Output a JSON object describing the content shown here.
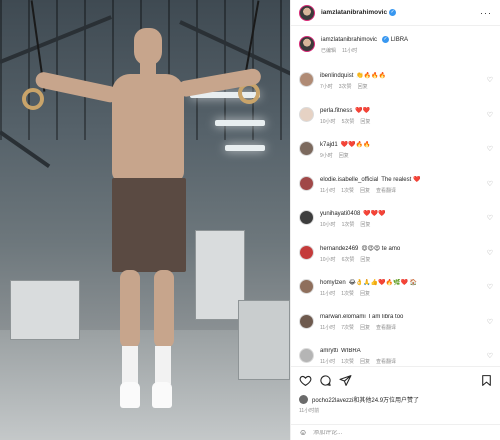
{
  "post": {
    "author": "iamzlatanibrahimovic",
    "caption": "LIBRA",
    "caption_status": "已编辑",
    "caption_time": "11小时"
  },
  "comments": [
    {
      "user": "ibenlindquist",
      "text": "👏🔥🔥🔥",
      "time": "7小时",
      "likes": "3次赞",
      "reply": "回复",
      "translate": ""
    },
    {
      "user": "perla.fitness",
      "text": "❤️❤️",
      "time": "10小时",
      "likes": "5次赞",
      "reply": "回复",
      "translate": ""
    },
    {
      "user": "k7ajd1",
      "text": "❤️❤️🔥🔥",
      "time": "9小时",
      "likes": "",
      "reply": "回复",
      "translate": ""
    },
    {
      "user": "elodie.isabelle_official",
      "text": "The realest ❤️",
      "time": "11小时",
      "likes": "1次赞",
      "reply": "回复",
      "translate": "查看翻译"
    },
    {
      "user": "yunihayati0408",
      "text": "❤️❤️❤️",
      "time": "10小时",
      "likes": "1次赞",
      "reply": "回复",
      "translate": ""
    },
    {
      "user": "hernandez469",
      "text": "😍😍😍 te amo",
      "time": "10小时",
      "likes": "6次赞",
      "reply": "回复",
      "translate": ""
    },
    {
      "user": "homylzen",
      "text": "😂👌🙏👍❤️🔥🌿❤️ 🏠",
      "time": "11小时",
      "likes": "1次赞",
      "reply": "回复",
      "translate": ""
    },
    {
      "user": "marwan.elomami",
      "text": "I am libra too",
      "time": "11小时",
      "likes": "7次赞",
      "reply": "回复",
      "translate": "查看翻译"
    },
    {
      "user": "amrytti",
      "text": "WIBRA",
      "time": "11小时",
      "likes": "1次赞",
      "reply": "回复",
      "translate": "查看翻译"
    }
  ],
  "likes_line": "pocho22lavezzi和其他24.9万位用户赞了",
  "post_time": "11小时前",
  "add_comment": {
    "placeholder": "添加评论..."
  },
  "colors": {
    "verified": "#3897f0",
    "secondary_text": "#8e8e8e",
    "story_ring": "#d62976"
  }
}
